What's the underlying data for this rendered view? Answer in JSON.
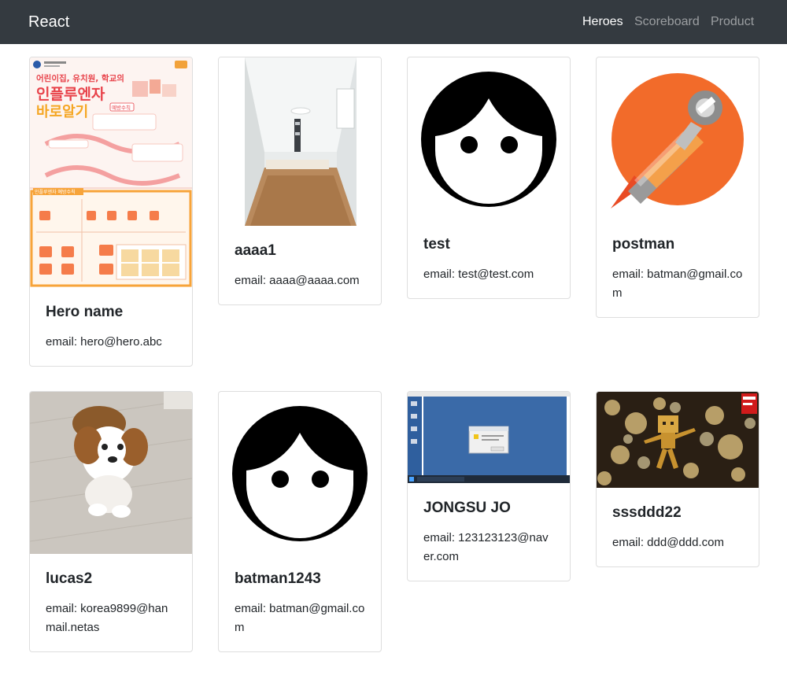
{
  "navbar": {
    "brand": "React",
    "links": [
      {
        "label": "Heroes",
        "active": true
      },
      {
        "label": "Scoreboard",
        "active": false
      },
      {
        "label": "Product",
        "active": false
      }
    ]
  },
  "heroes": [
    {
      "name": "Hero name",
      "email_label": "email: hero@hero.abc",
      "image": "influenza-poster",
      "image_text": {
        "title_line1": "어린이집, 유치원, 학교의",
        "title_line2": "인플루엔자",
        "title_line3": "바로알기",
        "badge": "예방수칙",
        "footer": "인플루엔자 예방수칙"
      }
    },
    {
      "name": "aaaa1",
      "email_label": "email: aaaa@aaaa.com",
      "image": "room-photo"
    },
    {
      "name": "test",
      "email_label": "email: test@test.com",
      "image": "face-avatar-icon"
    },
    {
      "name": "postman",
      "email_label": "email: batman@gmail.com",
      "image": "postman-logo"
    },
    {
      "name": "lucas2",
      "email_label": "email: korea9899@hanmail.netas",
      "image": "dog-photo"
    },
    {
      "name": "batman1243",
      "email_label": "email: batman@gmail.com",
      "image": "face-avatar-icon"
    },
    {
      "name": "JONGSU JO",
      "email_label": "email: 123123123@naver.com",
      "image": "desktop-screenshot"
    },
    {
      "name": "sssddd22",
      "email_label": "email: ddd@ddd.com",
      "image": "danbo-photo"
    }
  ],
  "colors": {
    "navbar_bg": "#343a40",
    "accent_orange": "#f26b2a",
    "poster_orange": "#f7a43a",
    "poster_red": "#e8424a"
  }
}
